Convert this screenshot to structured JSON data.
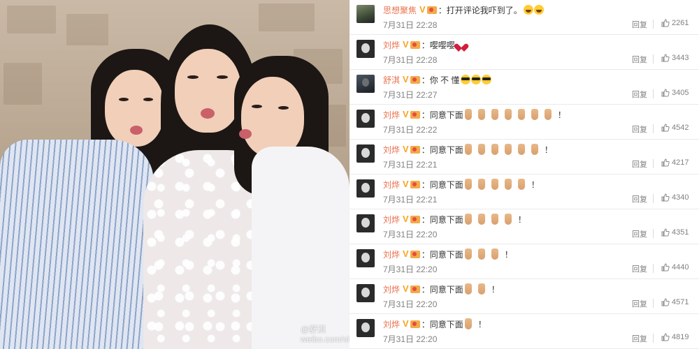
{
  "photo": {
    "watermark_handle": "@舒淇",
    "watermark_url": "weibo.com/shuqi"
  },
  "comments": [
    {
      "user": "思想聚焦",
      "avatar": "landscape-avatar-icon",
      "text": "：打开评论我吓到了。",
      "emojis": [
        "laugh",
        "laugh"
      ],
      "time": "7月31日 22:28",
      "reply": "回复",
      "likes": "2261"
    },
    {
      "user": "刘烨",
      "avatar": "baby-avatar-icon",
      "text": "：嘤嘤嘤",
      "emojis": [
        "heart"
      ],
      "time": "7月31日 22:28",
      "reply": "回复",
      "likes": "3443"
    },
    {
      "user": "舒淇",
      "avatar": "portrait-avatar-icon",
      "text": "：你 不 懂",
      "emojis": [
        "cool",
        "cool",
        "cool"
      ],
      "time": "7月31日 22:27",
      "reply": "回复",
      "likes": "3405"
    },
    {
      "user": "刘烨",
      "avatar": "baby-avatar-icon",
      "text": "：同意下面",
      "emojis": [
        "hand",
        "hand",
        "hand",
        "hand",
        "hand",
        "hand",
        "hand"
      ],
      "suffix": "！",
      "time": "7月31日 22:22",
      "reply": "回复",
      "likes": "4542"
    },
    {
      "user": "刘烨",
      "avatar": "baby-avatar-icon",
      "text": "：同意下面",
      "emojis": [
        "hand",
        "hand",
        "hand",
        "hand",
        "hand",
        "hand"
      ],
      "suffix": "！",
      "time": "7月31日 22:21",
      "reply": "回复",
      "likes": "4217"
    },
    {
      "user": "刘烨",
      "avatar": "baby-avatar-icon",
      "text": "：同意下面",
      "emojis": [
        "hand",
        "hand",
        "hand",
        "hand",
        "hand"
      ],
      "suffix": "！",
      "time": "7月31日 22:21",
      "reply": "回复",
      "likes": "4340"
    },
    {
      "user": "刘烨",
      "avatar": "baby-avatar-icon",
      "text": "：同意下面",
      "emojis": [
        "hand",
        "hand",
        "hand",
        "hand"
      ],
      "suffix": "！",
      "time": "7月31日 22:20",
      "reply": "回复",
      "likes": "4351"
    },
    {
      "user": "刘烨",
      "avatar": "baby-avatar-icon",
      "text": "：同意下面",
      "emojis": [
        "hand",
        "hand",
        "hand"
      ],
      "suffix": "！",
      "time": "7月31日 22:20",
      "reply": "回复",
      "likes": "4440"
    },
    {
      "user": "刘烨",
      "avatar": "baby-avatar-icon",
      "text": "：同意下面",
      "emojis": [
        "hand",
        "hand"
      ],
      "suffix": "！",
      "time": "7月31日 22:20",
      "reply": "回复",
      "likes": "4571"
    },
    {
      "user": "刘烨",
      "avatar": "baby-avatar-icon",
      "text": "：同意下面",
      "emojis": [
        "hand"
      ],
      "suffix": "！",
      "time": "7月31日 22:20",
      "reply": "回复",
      "likes": "4819"
    }
  ]
}
